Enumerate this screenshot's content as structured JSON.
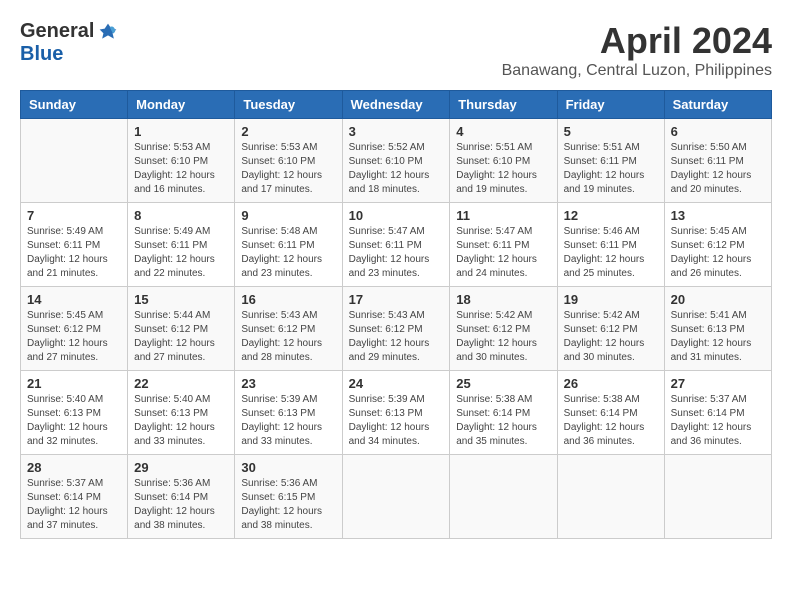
{
  "logo": {
    "general": "General",
    "blue": "Blue"
  },
  "title": "April 2024",
  "location": "Banawang, Central Luzon, Philippines",
  "headers": [
    "Sunday",
    "Monday",
    "Tuesday",
    "Wednesday",
    "Thursday",
    "Friday",
    "Saturday"
  ],
  "weeks": [
    [
      {
        "day": "",
        "sunrise": "",
        "sunset": "",
        "daylight": ""
      },
      {
        "day": "1",
        "sunrise": "Sunrise: 5:53 AM",
        "sunset": "Sunset: 6:10 PM",
        "daylight": "Daylight: 12 hours and 16 minutes."
      },
      {
        "day": "2",
        "sunrise": "Sunrise: 5:53 AM",
        "sunset": "Sunset: 6:10 PM",
        "daylight": "Daylight: 12 hours and 17 minutes."
      },
      {
        "day": "3",
        "sunrise": "Sunrise: 5:52 AM",
        "sunset": "Sunset: 6:10 PM",
        "daylight": "Daylight: 12 hours and 18 minutes."
      },
      {
        "day": "4",
        "sunrise": "Sunrise: 5:51 AM",
        "sunset": "Sunset: 6:10 PM",
        "daylight": "Daylight: 12 hours and 19 minutes."
      },
      {
        "day": "5",
        "sunrise": "Sunrise: 5:51 AM",
        "sunset": "Sunset: 6:11 PM",
        "daylight": "Daylight: 12 hours and 19 minutes."
      },
      {
        "day": "6",
        "sunrise": "Sunrise: 5:50 AM",
        "sunset": "Sunset: 6:11 PM",
        "daylight": "Daylight: 12 hours and 20 minutes."
      }
    ],
    [
      {
        "day": "7",
        "sunrise": "Sunrise: 5:49 AM",
        "sunset": "Sunset: 6:11 PM",
        "daylight": "Daylight: 12 hours and 21 minutes."
      },
      {
        "day": "8",
        "sunrise": "Sunrise: 5:49 AM",
        "sunset": "Sunset: 6:11 PM",
        "daylight": "Daylight: 12 hours and 22 minutes."
      },
      {
        "day": "9",
        "sunrise": "Sunrise: 5:48 AM",
        "sunset": "Sunset: 6:11 PM",
        "daylight": "Daylight: 12 hours and 23 minutes."
      },
      {
        "day": "10",
        "sunrise": "Sunrise: 5:47 AM",
        "sunset": "Sunset: 6:11 PM",
        "daylight": "Daylight: 12 hours and 23 minutes."
      },
      {
        "day": "11",
        "sunrise": "Sunrise: 5:47 AM",
        "sunset": "Sunset: 6:11 PM",
        "daylight": "Daylight: 12 hours and 24 minutes."
      },
      {
        "day": "12",
        "sunrise": "Sunrise: 5:46 AM",
        "sunset": "Sunset: 6:11 PM",
        "daylight": "Daylight: 12 hours and 25 minutes."
      },
      {
        "day": "13",
        "sunrise": "Sunrise: 5:45 AM",
        "sunset": "Sunset: 6:12 PM",
        "daylight": "Daylight: 12 hours and 26 minutes."
      }
    ],
    [
      {
        "day": "14",
        "sunrise": "Sunrise: 5:45 AM",
        "sunset": "Sunset: 6:12 PM",
        "daylight": "Daylight: 12 hours and 27 minutes."
      },
      {
        "day": "15",
        "sunrise": "Sunrise: 5:44 AM",
        "sunset": "Sunset: 6:12 PM",
        "daylight": "Daylight: 12 hours and 27 minutes."
      },
      {
        "day": "16",
        "sunrise": "Sunrise: 5:43 AM",
        "sunset": "Sunset: 6:12 PM",
        "daylight": "Daylight: 12 hours and 28 minutes."
      },
      {
        "day": "17",
        "sunrise": "Sunrise: 5:43 AM",
        "sunset": "Sunset: 6:12 PM",
        "daylight": "Daylight: 12 hours and 29 minutes."
      },
      {
        "day": "18",
        "sunrise": "Sunrise: 5:42 AM",
        "sunset": "Sunset: 6:12 PM",
        "daylight": "Daylight: 12 hours and 30 minutes."
      },
      {
        "day": "19",
        "sunrise": "Sunrise: 5:42 AM",
        "sunset": "Sunset: 6:12 PM",
        "daylight": "Daylight: 12 hours and 30 minutes."
      },
      {
        "day": "20",
        "sunrise": "Sunrise: 5:41 AM",
        "sunset": "Sunset: 6:13 PM",
        "daylight": "Daylight: 12 hours and 31 minutes."
      }
    ],
    [
      {
        "day": "21",
        "sunrise": "Sunrise: 5:40 AM",
        "sunset": "Sunset: 6:13 PM",
        "daylight": "Daylight: 12 hours and 32 minutes."
      },
      {
        "day": "22",
        "sunrise": "Sunrise: 5:40 AM",
        "sunset": "Sunset: 6:13 PM",
        "daylight": "Daylight: 12 hours and 33 minutes."
      },
      {
        "day": "23",
        "sunrise": "Sunrise: 5:39 AM",
        "sunset": "Sunset: 6:13 PM",
        "daylight": "Daylight: 12 hours and 33 minutes."
      },
      {
        "day": "24",
        "sunrise": "Sunrise: 5:39 AM",
        "sunset": "Sunset: 6:13 PM",
        "daylight": "Daylight: 12 hours and 34 minutes."
      },
      {
        "day": "25",
        "sunrise": "Sunrise: 5:38 AM",
        "sunset": "Sunset: 6:14 PM",
        "daylight": "Daylight: 12 hours and 35 minutes."
      },
      {
        "day": "26",
        "sunrise": "Sunrise: 5:38 AM",
        "sunset": "Sunset: 6:14 PM",
        "daylight": "Daylight: 12 hours and 36 minutes."
      },
      {
        "day": "27",
        "sunrise": "Sunrise: 5:37 AM",
        "sunset": "Sunset: 6:14 PM",
        "daylight": "Daylight: 12 hours and 36 minutes."
      }
    ],
    [
      {
        "day": "28",
        "sunrise": "Sunrise: 5:37 AM",
        "sunset": "Sunset: 6:14 PM",
        "daylight": "Daylight: 12 hours and 37 minutes."
      },
      {
        "day": "29",
        "sunrise": "Sunrise: 5:36 AM",
        "sunset": "Sunset: 6:14 PM",
        "daylight": "Daylight: 12 hours and 38 minutes."
      },
      {
        "day": "30",
        "sunrise": "Sunrise: 5:36 AM",
        "sunset": "Sunset: 6:15 PM",
        "daylight": "Daylight: 12 hours and 38 minutes."
      },
      {
        "day": "",
        "sunrise": "",
        "sunset": "",
        "daylight": ""
      },
      {
        "day": "",
        "sunrise": "",
        "sunset": "",
        "daylight": ""
      },
      {
        "day": "",
        "sunrise": "",
        "sunset": "",
        "daylight": ""
      },
      {
        "day": "",
        "sunrise": "",
        "sunset": "",
        "daylight": ""
      }
    ]
  ]
}
